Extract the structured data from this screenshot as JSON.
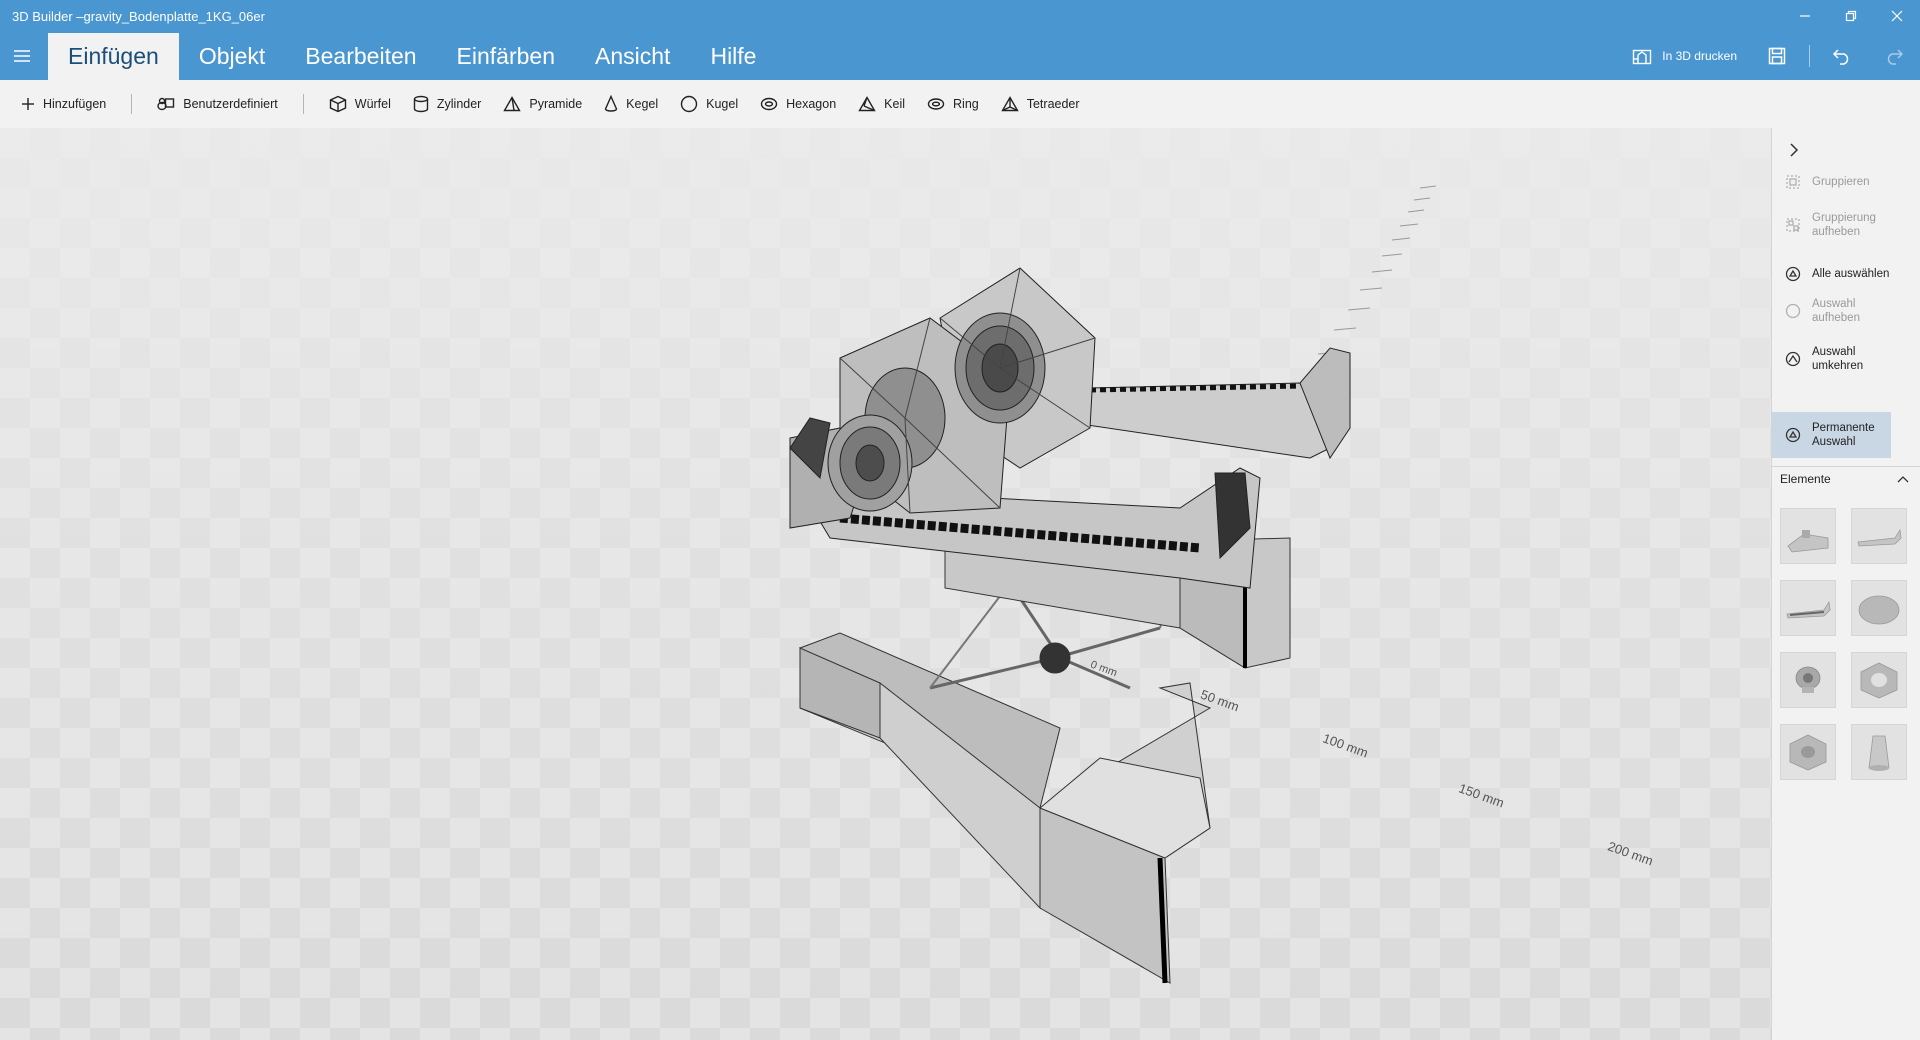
{
  "window": {
    "title": "3D Builder –gravity_Bodenplatte_1KG_06er"
  },
  "ribbon": {
    "tabs": [
      {
        "label": "Einfügen"
      },
      {
        "label": "Objekt"
      },
      {
        "label": "Bearbeiten"
      },
      {
        "label": "Einfärben"
      },
      {
        "label": "Ansicht"
      },
      {
        "label": "Hilfe"
      }
    ],
    "print_label": "In 3D drucken"
  },
  "toolbar": {
    "items": [
      {
        "label": "Hinzufügen",
        "icon": "plus-icon"
      },
      {
        "label": "Benutzerdefiniert",
        "icon": "custom-shapes-icon"
      },
      {
        "label": "Würfel",
        "icon": "cube-icon"
      },
      {
        "label": "Zylinder",
        "icon": "cylinder-icon"
      },
      {
        "label": "Pyramide",
        "icon": "pyramid-icon"
      },
      {
        "label": "Kegel",
        "icon": "cone-icon"
      },
      {
        "label": "Kugel",
        "icon": "sphere-icon"
      },
      {
        "label": "Hexagon",
        "icon": "hexagon-icon"
      },
      {
        "label": "Keil",
        "icon": "wedge-icon"
      },
      {
        "label": "Ring",
        "icon": "ring-icon"
      },
      {
        "label": "Tetraeder",
        "icon": "tetrahedron-icon"
      }
    ]
  },
  "viewport": {
    "ruler": [
      "0 mm",
      "50 mm",
      "100 mm",
      "150 mm",
      "200 mm"
    ],
    "colors": {
      "floor": "#e4e4e4",
      "model": "#c8c8c8",
      "mesh": "#444444"
    }
  },
  "side_panel": {
    "actions": [
      {
        "label": "Gruppieren",
        "state": "disabled"
      },
      {
        "label": "Gruppierung aufheben",
        "state": "disabled"
      },
      {
        "label": "Alle auswählen",
        "state": "enabled"
      },
      {
        "label": "Auswahl aufheben",
        "state": "disabled"
      },
      {
        "label": "Auswahl umkehren",
        "state": "enabled"
      },
      {
        "label": "Permanente Auswahl",
        "state": "selected"
      }
    ],
    "section_title": "Elemente"
  },
  "accent_color": "#4a96d1"
}
